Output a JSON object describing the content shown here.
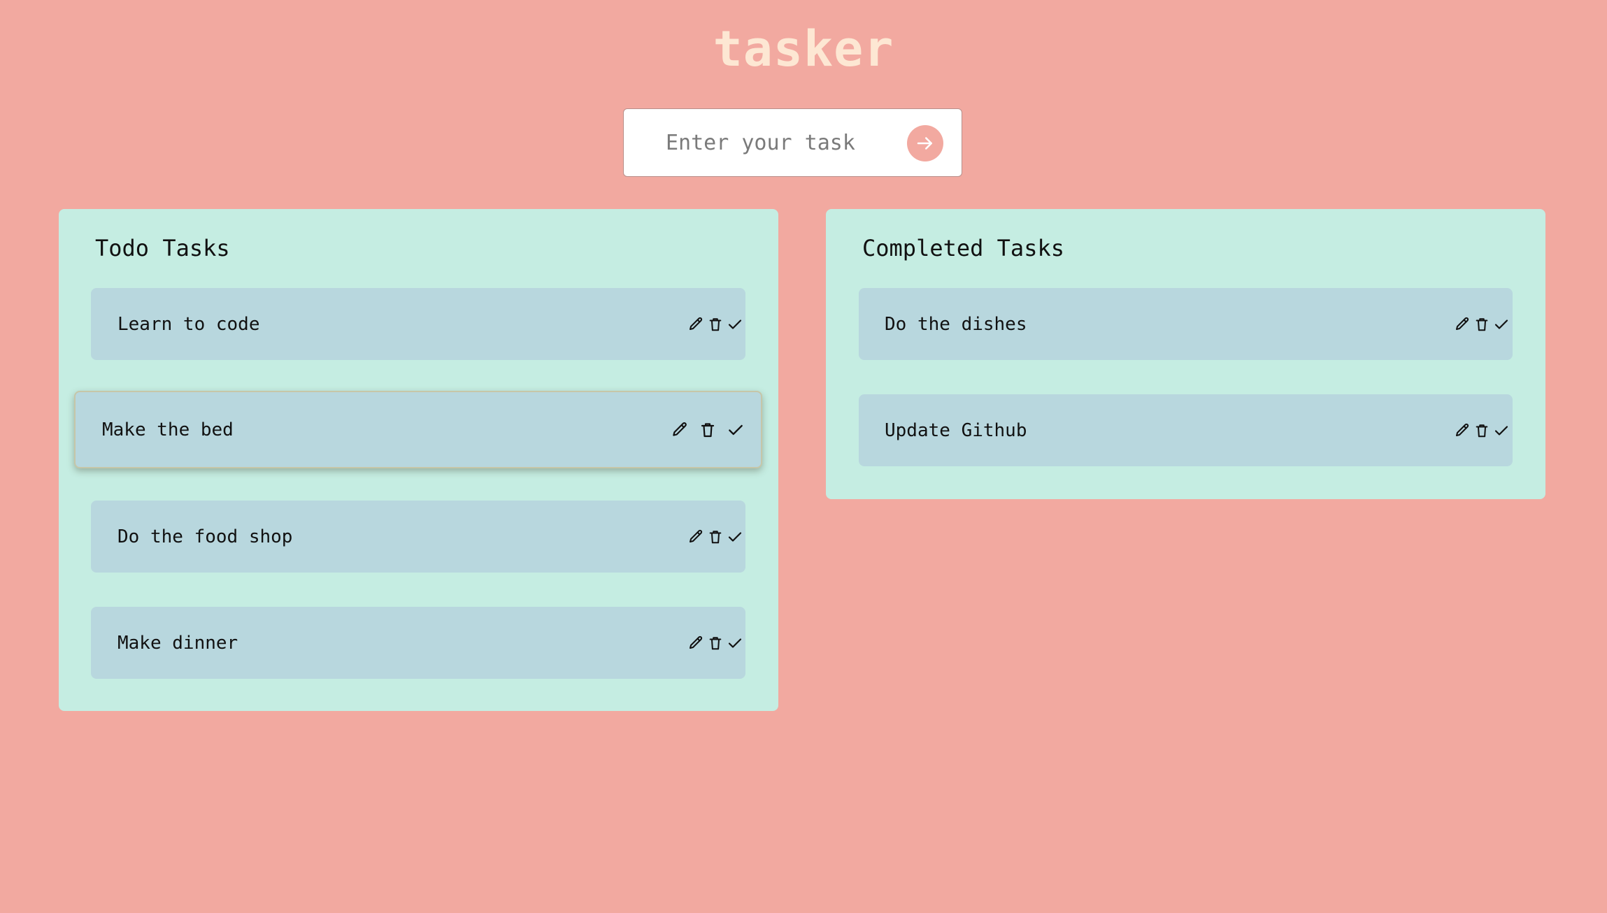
{
  "app": {
    "title": "tasker"
  },
  "input": {
    "placeholder": "Enter your task",
    "submit_icon": "arrow-right-icon"
  },
  "todo": {
    "title": "Todo Tasks",
    "tasks": [
      {
        "label": "Learn to code"
      },
      {
        "label": "Make the bed"
      },
      {
        "label": "Do the food shop"
      },
      {
        "label": "Make dinner"
      }
    ]
  },
  "completed": {
    "title": "Completed Tasks",
    "tasks": [
      {
        "label": "Do the dishes"
      },
      {
        "label": "Update Github"
      }
    ]
  },
  "task_actions": [
    "pencil-icon",
    "trash-icon",
    "check-icon"
  ],
  "colors": {
    "background": "#f2a9a0",
    "title": "#fde7d3",
    "panel": "#c5ede2",
    "card": "#b8d7de",
    "accent": "#f2a9a0"
  }
}
